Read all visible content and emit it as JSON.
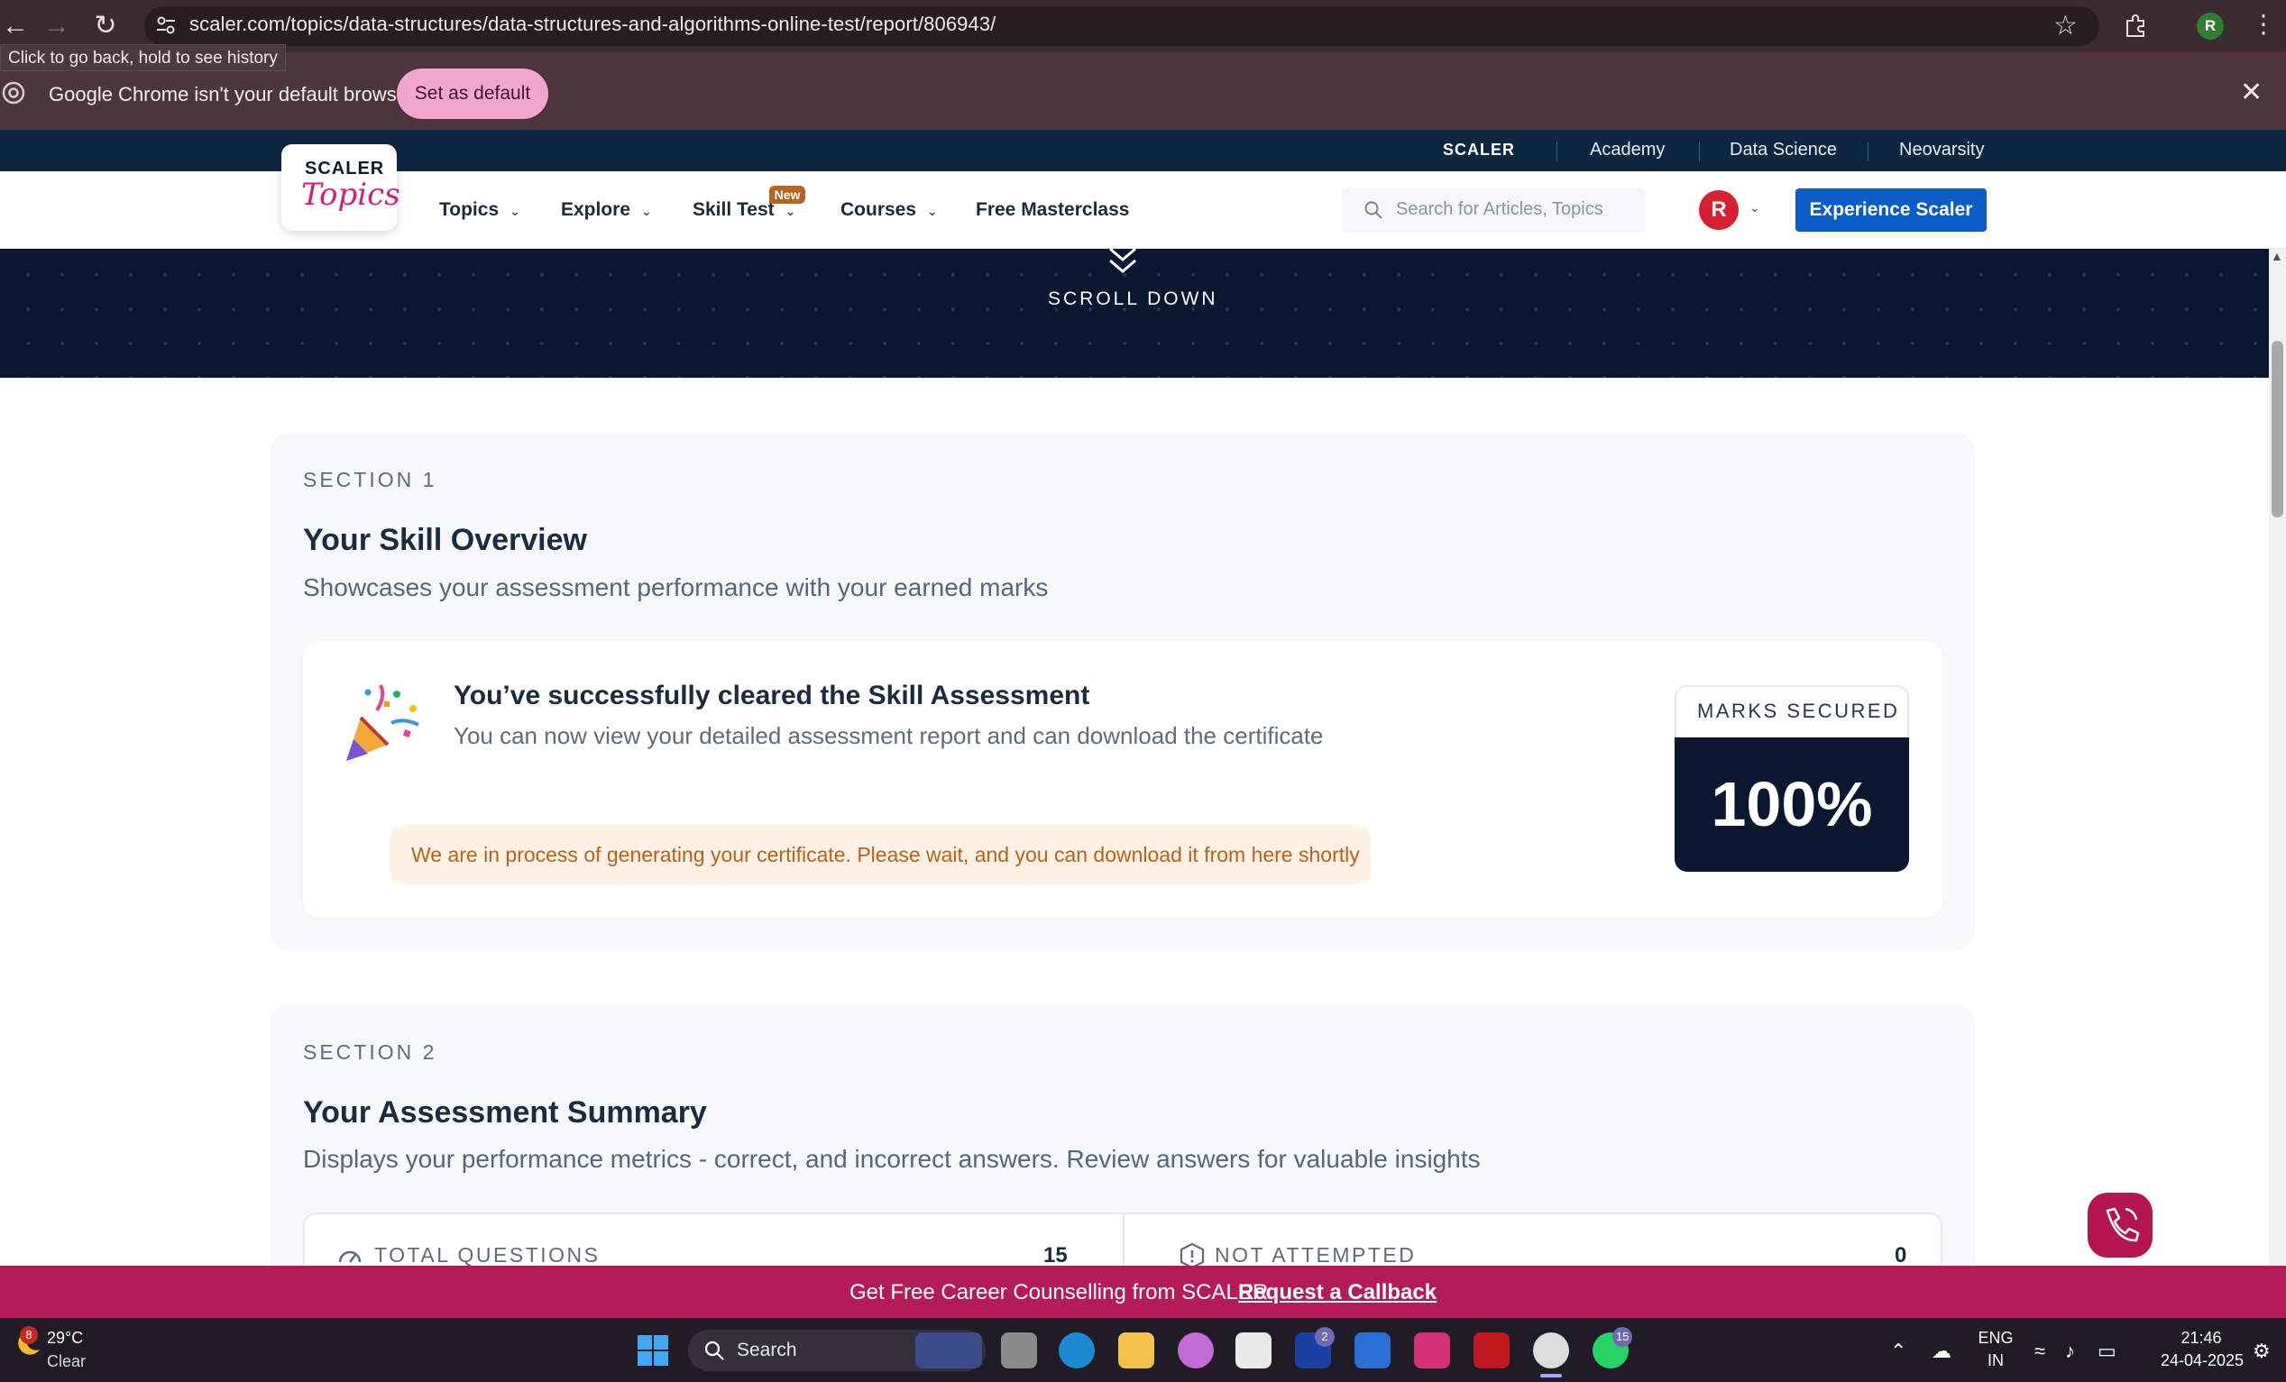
{
  "browser": {
    "url": "scaler.com/topics/data-structures/data-structures-and-algorithms-online-test/report/806943/",
    "profile_initial": "R",
    "back_tooltip": "Click to go back, hold to see history"
  },
  "infobar": {
    "message": "Google Chrome isn't your default browser",
    "set_default_label": "Set as default"
  },
  "scaler_strip": {
    "logo": "SCALER",
    "links": [
      "Academy",
      "Data Science",
      "Neovarsity"
    ]
  },
  "nav": {
    "logo_top": "SCALER",
    "logo_bottom": "Topics",
    "items": [
      {
        "label": "Topics"
      },
      {
        "label": "Explore"
      },
      {
        "label": "Skill Test",
        "badge": "New"
      },
      {
        "label": "Courses"
      },
      {
        "label": "Free Masterclass"
      }
    ],
    "search_placeholder": "Search for Articles, Topics",
    "avatar_initial": "R",
    "cta_label": "Experience Scaler"
  },
  "hero": {
    "scroll_text": "SCROLL DOWN"
  },
  "section1": {
    "label": "SECTION 1",
    "title": "Your Skill Overview",
    "subtitle": "Showcases your assessment performance with your earned marks",
    "result_title": "You’ve successfully cleared the Skill Assessment",
    "result_subtitle": "You can now view your detailed assessment report and can download the certificate",
    "certificate_notice": "We are in process of generating your certificate. Please wait, and you can download it from here shortly",
    "marks_label": "MARKS SECURED",
    "marks_value": "100%"
  },
  "section2": {
    "label": "SECTION 2",
    "title": "Your Assessment Summary",
    "subtitle": "Displays your performance metrics - correct, and incorrect answers. Review answers for valuable insights",
    "stats": [
      {
        "label": "TOTAL QUESTIONS",
        "value": "15"
      },
      {
        "label": "NOT ATTEMPTED",
        "value": "0"
      }
    ]
  },
  "career_banner": {
    "text": "Get Free Career Counselling from SCALER:",
    "link": "Request a Callback"
  },
  "taskbar": {
    "weather_badge": "8",
    "temperature": "29°C",
    "weather": "Clear",
    "search_label": "Search",
    "badges": {
      "linkedin": "2",
      "whatsapp": "15"
    },
    "language": "ENG",
    "region": "IN",
    "time": "21:46",
    "date": "24-04-2025"
  }
}
